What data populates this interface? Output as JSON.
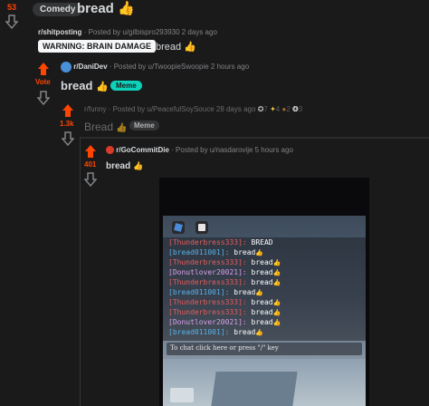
{
  "post1": {
    "score": "53",
    "flair": "Comedy",
    "title": "bread"
  },
  "post2": {
    "subreddit": "r/shitposting",
    "meta": "· Posted by u/gilbispro293930 2 days ago",
    "flair": "WARNING: BRAIN DAMAGE",
    "title": "bread"
  },
  "post3": {
    "vote_label": "Vote",
    "subreddit": "r/DaniDev",
    "meta": "· Posted by u/TwoopieSwoopie 2 hours ago",
    "title": "bread",
    "flair": "Meme"
  },
  "post4": {
    "score": "1.3k",
    "meta": "r/funny · Posted by u/PeacefulSoySouce 28 days ago",
    "awards": [
      "7",
      "4",
      "2",
      "3"
    ],
    "title": "Bread",
    "flair": "Meme"
  },
  "post5": {
    "score": "401",
    "subreddit": "r/GoCommitDie",
    "meta": "· Posted by u/nasdarovije 5 hours ago",
    "title": "bread"
  },
  "chat": {
    "lines": [
      {
        "name": "[Thunderbress333]:",
        "msg": "BREAD",
        "color": "#e85c5c"
      },
      {
        "name": "[bread011001]:",
        "msg": "bread",
        "color": "#5ab0e8"
      },
      {
        "name": "[Thunderbress333]:",
        "msg": "bread",
        "color": "#e85c5c"
      },
      {
        "name": "[Donutlover20021]:",
        "msg": "bread",
        "color": "#d9a0e8"
      },
      {
        "name": "[Thunderbress333]:",
        "msg": "bread",
        "color": "#e85c5c"
      },
      {
        "name": "[bread011001]:",
        "msg": "bread",
        "color": "#5ab0e8"
      },
      {
        "name": "[Thunderbress333]:",
        "msg": "bread",
        "color": "#e85c5c"
      },
      {
        "name": "[Thunderbress333]:",
        "msg": "bread",
        "color": "#e85c5c"
      },
      {
        "name": "[Donutlover20021]:",
        "msg": "bread",
        "color": "#d9a0e8"
      },
      {
        "name": "[bread011001]:",
        "msg": "bread",
        "color": "#5ab0e8"
      }
    ],
    "input_placeholder": "To chat click here or press \"/\" key"
  },
  "colors": {
    "upvote": "#ff4500",
    "meme_flair": "#0dd3bb",
    "background": "#1a1a1b"
  }
}
